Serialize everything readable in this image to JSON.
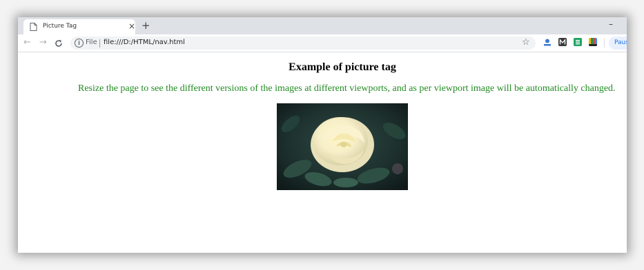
{
  "browser": {
    "tab": {
      "title": "Picture Tag",
      "close_glyph": "×",
      "icon": "document-icon"
    },
    "new_tab_glyph": "+",
    "minimize_glyph": "–",
    "toolbar": {
      "back_glyph": "←",
      "forward_glyph": "→",
      "reload_glyph": "C",
      "info_glyph": "i",
      "scheme_label": "File",
      "url": "file:///D:/HTML/nav.html",
      "star_glyph": "☆",
      "pause_label": "Paused"
    },
    "extensions": [
      "profile-ext-icon",
      "m-ext-icon",
      "green-ext-icon",
      "color-bars-ext-icon"
    ]
  },
  "page": {
    "heading": "Example of picture tag",
    "description": "Resize the page to see the different versions of the images at different viewports, and as per viewport image will be automatically changed.",
    "description_color": "#228b22",
    "image": {
      "subject": "white-rose"
    }
  }
}
